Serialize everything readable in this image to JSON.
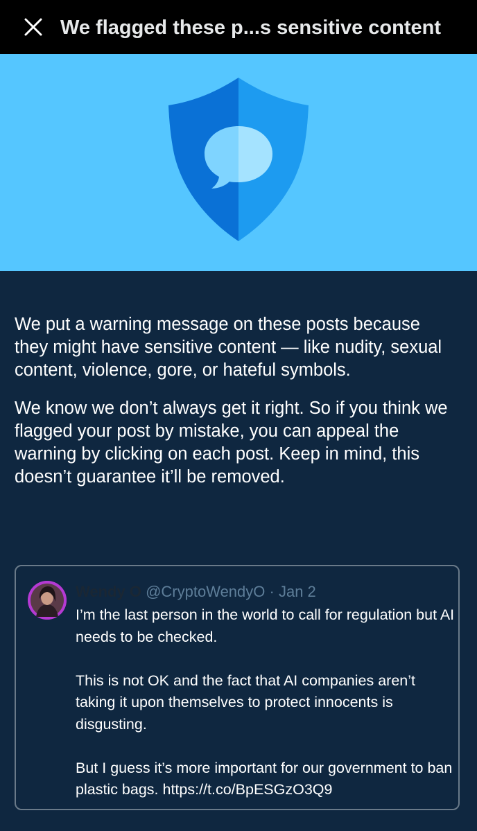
{
  "header": {
    "close_icon": "close-icon",
    "title": "We flagged these p...s sensitive content"
  },
  "banner": {
    "icon": "shield-chat-bubble-icon",
    "background": "#55c6ff"
  },
  "explanation": {
    "paragraph1": "We put a warning message on these posts because they might have sensitive content — like nudity, sexual content, violence, gore, or hateful symbols.",
    "paragraph2": "We know we don’t always get it right. So if you think we flagged your post by mistake, you can appeal the warning by clicking on each post. Keep in mind, this doesn’t guarantee it’ll be removed."
  },
  "post": {
    "display_name": "Wendy O",
    "handle": "@CryptoWendyO",
    "separator": " · ",
    "date": "Jan 2",
    "body1": "I’m the last person in the world to call for regulation but AI needs to be checked.",
    "body2": "This is not OK and the fact that AI companies aren’t taking it upon themselves to protect innocents is disgusting.",
    "body3": "But I guess it’s more important for our government to ban plastic bags. https://t.co/BpESGzO3Q9"
  }
}
